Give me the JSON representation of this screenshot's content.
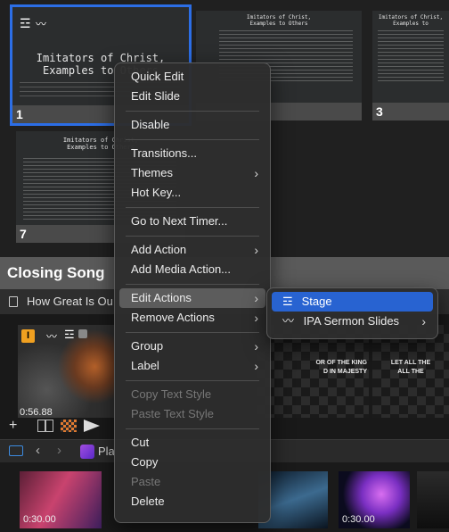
{
  "slides": [
    {
      "number": "1",
      "title_line1": "Imitators of Christ,",
      "title_line2": "Examples to Others"
    },
    {
      "number": "",
      "title_line1": "Imitators of Christ,",
      "title_line2": "Examples to Others"
    },
    {
      "number": "3",
      "title_line1": "Imitators of Christ,",
      "title_line2": "Examples to"
    },
    {
      "number": "7",
      "title_line1": "Imitators of Christ,",
      "title_line2": "Examples to Others"
    }
  ],
  "section": {
    "title": "Closing Song"
  },
  "song": {
    "title": "How Great Is Ou"
  },
  "song_slides": [
    {
      "time": "0:56.88"
    },
    {
      "text_line1": "OR OF THE KING",
      "text_line2": "D IN MAJESTY"
    },
    {
      "text_line1": "LET ALL THE",
      "text_line2": "ALL THE"
    }
  ],
  "song_badge": {
    "label": "I",
    "color": "#f0a020"
  },
  "toolbar": {
    "playlist_label": "Pla"
  },
  "media_items": [
    {
      "time": "0:30.00"
    },
    {
      "time": ""
    },
    {
      "time": ""
    },
    {
      "time": "0:30.00"
    }
  ],
  "context_menu": {
    "group1": [
      "Quick Edit",
      "Edit Slide"
    ],
    "group2": [
      "Disable"
    ],
    "group3": [
      "Transitions...",
      "Themes",
      "Hot Key..."
    ],
    "group4": [
      "Go to Next Timer..."
    ],
    "group5": [
      "Add Action",
      "Add Media Action..."
    ],
    "group6": [
      "Edit Actions",
      "Remove Actions"
    ],
    "group7": [
      "Group",
      "Label"
    ],
    "group8": [
      "Copy Text Style",
      "Paste Text Style"
    ],
    "group9": [
      "Cut",
      "Copy",
      "Paste",
      "Delete"
    ]
  },
  "submenu": {
    "items": [
      "Stage",
      "IPA Sermon Slides"
    ]
  },
  "colors": {
    "accent": "#2863d1",
    "selection": "#2c6ee6",
    "badge": "#f0a020"
  }
}
